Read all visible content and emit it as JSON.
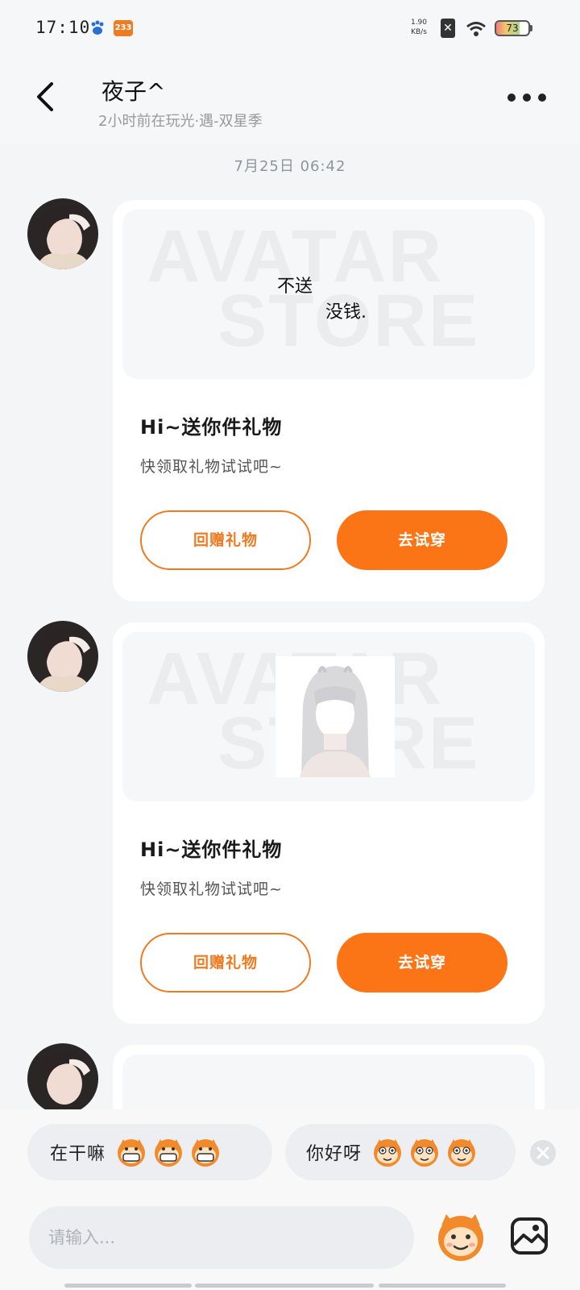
{
  "status_bar": {
    "time": "17:10",
    "app_badge": "233",
    "net_speed_value": "1.90",
    "net_speed_unit": "KB/s",
    "sim_indicator": "✕",
    "battery_level": "73",
    "battery_fraction": 0.73
  },
  "header": {
    "contact_name": "夜子^",
    "contact_status": "2小时前在玩光·遇-双星季"
  },
  "timestamp": "7月25日 06:42",
  "messages": [
    {
      "banner_text_line1": "不送",
      "banner_text_line2": "没钱.",
      "watermark_line1": "AVATAR",
      "watermark_line2": "STORE",
      "title": "Hi~送你件礼物",
      "description": "快领取礼物试试吧~",
      "return_gift_label": "回赠礼物",
      "try_on_label": "去试穿"
    },
    {
      "watermark_line1": "AVATAR",
      "watermark_line2": "STORE",
      "title": "Hi~送你件礼物",
      "description": "快领取礼物试试吧~",
      "return_gift_label": "回赠礼物",
      "try_on_label": "去试穿"
    }
  ],
  "quick_replies": [
    {
      "text": "在干嘛"
    },
    {
      "text": "你好呀"
    }
  ],
  "input": {
    "placeholder": "请输入..."
  },
  "colors": {
    "accent": "#fb7516",
    "background": "#f3f5f7",
    "card": "#ffffff"
  },
  "icons": [
    "back-arrow-icon",
    "more-dots-icon",
    "sticker-icon",
    "image-icon",
    "close-icon"
  ]
}
